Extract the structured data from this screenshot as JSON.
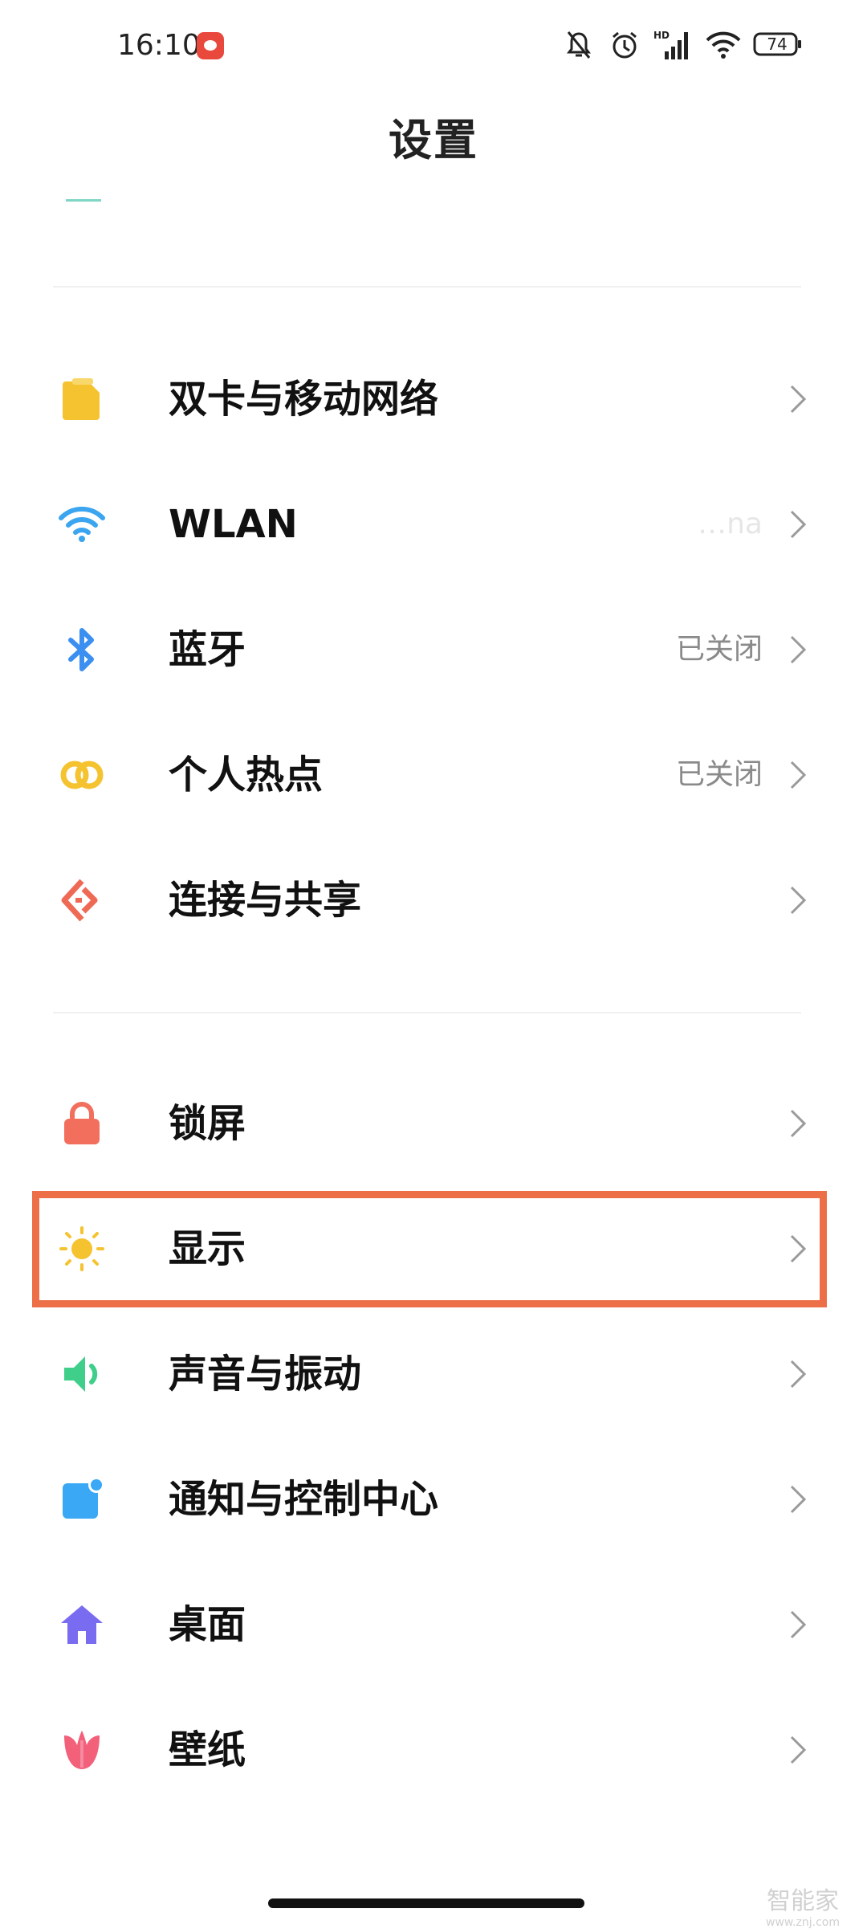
{
  "status_bar": {
    "time": "16:10",
    "battery": "74",
    "network_badge": "HD"
  },
  "header": {
    "title": "设置"
  },
  "rows": [
    {
      "label": "双卡与移动网络",
      "status": "",
      "icon": "sim-card-icon",
      "color": "#f5c330"
    },
    {
      "label": "WLAN",
      "status": "…na",
      "icon": "wifi-icon",
      "color": "#3ba5f0"
    },
    {
      "label": "蓝牙",
      "status": "已关闭",
      "icon": "bluetooth-icon",
      "color": "#3a8ff0"
    },
    {
      "label": "个人热点",
      "status": "已关闭",
      "icon": "hotspot-icon",
      "color": "#f5c330"
    },
    {
      "label": "连接与共享",
      "status": "",
      "icon": "connection-share-icon",
      "color": "#ee6a55"
    },
    {
      "label": "锁屏",
      "status": "",
      "icon": "lock-icon",
      "color": "#f26f5e"
    },
    {
      "label": "显示",
      "status": "",
      "icon": "sun-icon",
      "color": "#f5c330",
      "highlighted": true
    },
    {
      "label": "声音与振动",
      "status": "",
      "icon": "speaker-icon",
      "color": "#3fcf8a"
    },
    {
      "label": "通知与控制中心",
      "status": "",
      "icon": "notification-icon",
      "color": "#3aa8f5"
    },
    {
      "label": "桌面",
      "status": "",
      "icon": "home-icon",
      "color": "#7a6cf0"
    },
    {
      "label": "壁纸",
      "status": "",
      "icon": "tulip-icon",
      "color": "#f2607a"
    }
  ],
  "watermark": {
    "main": "智能家",
    "sub": "www.znj.com"
  }
}
